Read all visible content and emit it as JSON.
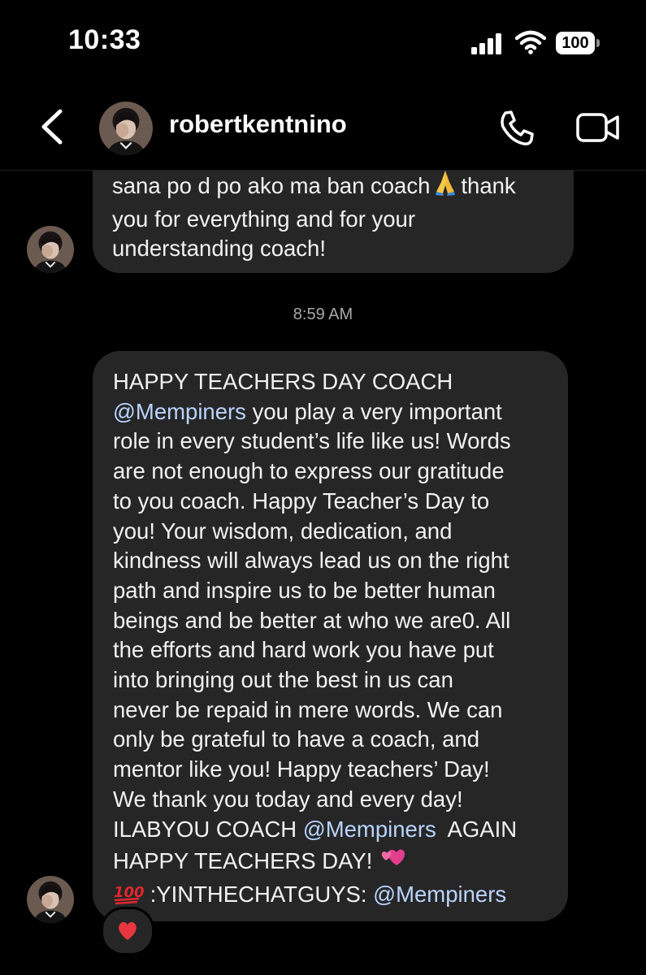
{
  "status_bar": {
    "time": "10:33",
    "battery": "100"
  },
  "header": {
    "username": "robertkentnino",
    "icons": [
      "chevron-left-icon",
      "phone-icon",
      "video-camera-icon"
    ]
  },
  "messages": [
    {
      "lines": [
        "sana po d po ako ma ban coach",
        "thank",
        "you for everything and for your",
        "understanding coach!"
      ],
      "emoji": "folded-hands"
    },
    {
      "lines": [
        "HAPPY TEACHERS DAY COACH",
        "@Mempiners",
        " you play a very important",
        "role in every student’s life like us! Words",
        "are not enough to express our gratitude",
        "to you coach. Happy Teacher’s Day to",
        "you! Your wisdom, dedication, and",
        "kindness will always lead us on the right",
        "path and inspire us to be better human",
        "beings and be better at who we are0. All",
        "the efforts and hard work you have put",
        "into bringing out the best in us can",
        "never be repaid in mere words. We can",
        "only be grateful to have a coach, and",
        "mentor like you! Happy teachers’ Day!",
        "We thank you today and every day!",
        "ILABYOU COACH ",
        "@Mempiners",
        "  AGAIN",
        "HAPPY TEACHERS DAY! ",
        " :YINTHECHATGUYS: ",
        "@Mempiners"
      ],
      "emojis": [
        "two-hearts",
        "hundred-points"
      ],
      "reaction": "red-heart"
    }
  ],
  "timestamp": "8:59 AM",
  "colors": {
    "background": "#000000",
    "bubble": "#262626",
    "mention": "#b9d4ff",
    "timestamp": "#a8a8a8"
  }
}
